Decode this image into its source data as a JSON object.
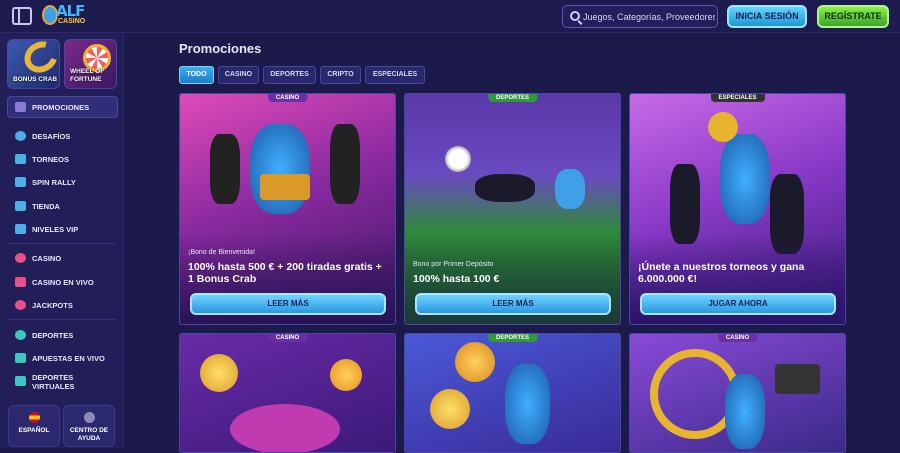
{
  "header": {
    "logo_text": "ALF",
    "logo_sub": "CASINO",
    "search_placeholder": "Juegos, Categorías, Proveedores",
    "login_label": "INICIA SESIÓN",
    "register_label": "REGÍSTRATE"
  },
  "sidebar": {
    "tiles": [
      {
        "label": "BONUS CRAB",
        "icon": "crab-claw-icon"
      },
      {
        "label": "WHEEL OF FORTUNE",
        "icon": "wheel-icon"
      }
    ],
    "items": [
      {
        "label": "PROMOCIONES",
        "icon": "gift-icon"
      },
      {
        "label": "DESAFÍOS",
        "icon": "target-icon"
      },
      {
        "label": "TORNEOS",
        "icon": "trophy-icon"
      },
      {
        "label": "SPIN RALLY",
        "icon": "rally-icon"
      },
      {
        "label": "TIENDA",
        "icon": "shop-icon"
      },
      {
        "label": "NIVELES VIP",
        "icon": "crown-icon"
      },
      {
        "label": "CASINO",
        "icon": "cherries-icon"
      },
      {
        "label": "CASINO EN VIVO",
        "icon": "live-casino-icon"
      },
      {
        "label": "JACKPOTS",
        "icon": "clover-icon"
      },
      {
        "label": "DEPORTES",
        "icon": "ball-icon"
      },
      {
        "label": "APUESTAS EN VIVO",
        "icon": "live-bet-icon"
      },
      {
        "label": "DEPORTES VIRTUALES",
        "icon": "controller-icon"
      }
    ],
    "language_label": "ESPAÑOL",
    "help_label": "CENTRO DE AYUDA"
  },
  "main": {
    "title": "Promociones",
    "tabs": [
      "TODO",
      "CASINO",
      "DEPORTES",
      "CRIPTO",
      "ESPECIALES"
    ],
    "cards": [
      {
        "badge": "CASINO",
        "subtitle": "¡Bono de Bienvenida!",
        "headline": "100% hasta 500 € + 200 tiradas gratis + 1 Bonus Crab",
        "cta": "LEER MÁS"
      },
      {
        "badge": "DEPORTES",
        "subtitle": "Bono por Primer Depósito",
        "headline": "100% hasta 100 €",
        "cta": "LEER MÁS"
      },
      {
        "badge": "ESPECIALES",
        "subtitle": "",
        "headline": "¡Únete a nuestros torneos y gana 6.000.000 €!",
        "cta": "JUGAR AHORA"
      },
      {
        "badge": "CASINO"
      },
      {
        "badge": "DEPORTES"
      },
      {
        "badge": "CASINO"
      }
    ]
  },
  "colors": {
    "background": "#1c1a4a",
    "accent_blue": "#2a97e0",
    "accent_green": "#3aa52a",
    "badge_casino": "#6a2fa8",
    "badge_sports": "#2e9a3a",
    "badge_special": "#333"
  }
}
